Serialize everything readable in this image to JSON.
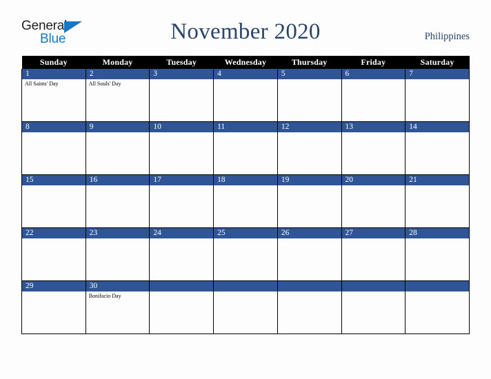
{
  "brand": {
    "name_part1": "General",
    "name_part2": "Blue",
    "flag_icon": "triangle-flag-icon",
    "accent_color": "#1878c4"
  },
  "header": {
    "title": "November 2020",
    "country": "Philippines",
    "title_color": "#2b4469"
  },
  "calendar": {
    "month": "November",
    "year": "2020",
    "accent_color": "#2f5597",
    "header_bg": "#000000",
    "weekdays": [
      "Sunday",
      "Monday",
      "Tuesday",
      "Wednesday",
      "Thursday",
      "Friday",
      "Saturday"
    ],
    "weeks": [
      [
        {
          "day": "1",
          "events": [
            "All Saints' Day"
          ]
        },
        {
          "day": "2",
          "events": [
            "All Souls' Day"
          ]
        },
        {
          "day": "3",
          "events": []
        },
        {
          "day": "4",
          "events": []
        },
        {
          "day": "5",
          "events": []
        },
        {
          "day": "6",
          "events": []
        },
        {
          "day": "7",
          "events": []
        }
      ],
      [
        {
          "day": "8",
          "events": []
        },
        {
          "day": "9",
          "events": []
        },
        {
          "day": "10",
          "events": []
        },
        {
          "day": "11",
          "events": []
        },
        {
          "day": "12",
          "events": []
        },
        {
          "day": "13",
          "events": []
        },
        {
          "day": "14",
          "events": []
        }
      ],
      [
        {
          "day": "15",
          "events": []
        },
        {
          "day": "16",
          "events": []
        },
        {
          "day": "17",
          "events": []
        },
        {
          "day": "18",
          "events": []
        },
        {
          "day": "19",
          "events": []
        },
        {
          "day": "20",
          "events": []
        },
        {
          "day": "21",
          "events": []
        }
      ],
      [
        {
          "day": "22",
          "events": []
        },
        {
          "day": "23",
          "events": []
        },
        {
          "day": "24",
          "events": []
        },
        {
          "day": "25",
          "events": []
        },
        {
          "day": "26",
          "events": []
        },
        {
          "day": "27",
          "events": []
        },
        {
          "day": "28",
          "events": []
        }
      ],
      [
        {
          "day": "29",
          "events": []
        },
        {
          "day": "30",
          "events": [
            "Bonifacio Day"
          ]
        },
        {
          "day": "",
          "events": []
        },
        {
          "day": "",
          "events": []
        },
        {
          "day": "",
          "events": []
        },
        {
          "day": "",
          "events": []
        },
        {
          "day": "",
          "events": []
        }
      ]
    ]
  }
}
